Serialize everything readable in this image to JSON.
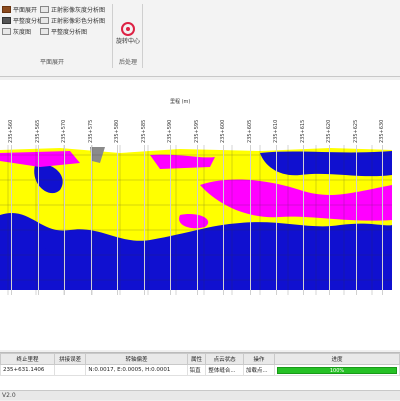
{
  "ribbon": {
    "items": [
      {
        "label": "平面展开",
        "icon": "plane-unfold-icon"
      },
      {
        "label": "平整度分析",
        "icon": "flatness-icon"
      },
      {
        "label": "灰度图",
        "icon": "grayscale-icon"
      },
      {
        "label": "正射影像灰度分析图",
        "icon": "ortho-gray-icon"
      },
      {
        "label": "正射影像彩色分析图",
        "icon": "ortho-color-icon"
      },
      {
        "label": "平整度分析图",
        "icon": "flatness-map-icon"
      }
    ],
    "group_label": "平面展开",
    "rotate_center_label": "旋转中心",
    "postprocess_label": "后处理"
  },
  "plot": {
    "x_axis_title": "里程 (m)",
    "ticks": [
      "235+560",
      "235+565",
      "235+570",
      "235+575",
      "235+580",
      "235+585",
      "235+590",
      "235+595",
      "235+600",
      "235+605",
      "235+610",
      "235+615",
      "235+620",
      "235+625",
      "235+630"
    ]
  },
  "table": {
    "headers": [
      "终止里程",
      "拼接误差",
      "转轴偏差",
      "属性",
      "点云状态",
      "操作",
      "进度"
    ],
    "rows": [
      [
        "235+631.1406",
        "",
        "N:0.0017, E:0.0005, H:0.0001",
        "铅直",
        "整体缝合...",
        "加载点...",
        "100%"
      ]
    ]
  },
  "status": {
    "text": "V2.0"
  },
  "colors": {
    "yellow": "#ffff00",
    "blue": "#1010d0",
    "magenta": "#ff00ff",
    "background": "#ffffff",
    "progress": "#25c125"
  }
}
